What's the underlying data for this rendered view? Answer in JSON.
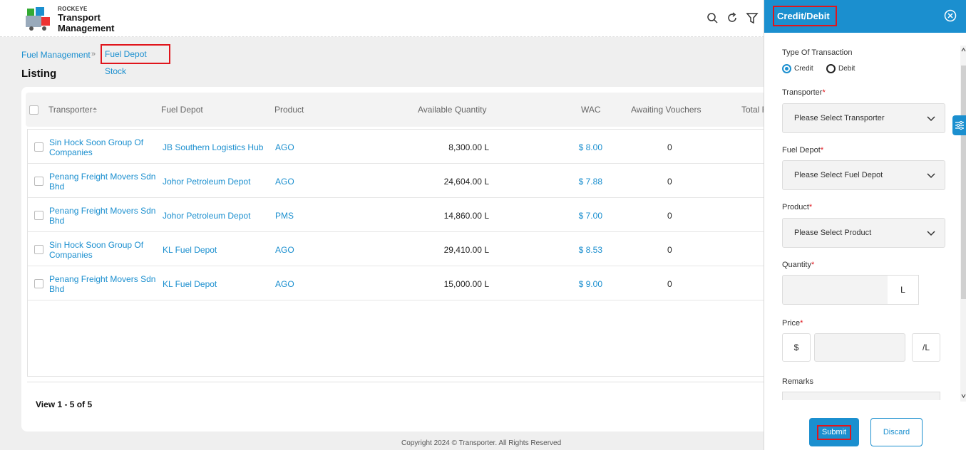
{
  "header": {
    "brand_small": "ROCKEYE",
    "brand_line1": "Transport",
    "brand_line2": "Management",
    "icons": [
      "search-icon",
      "refresh-icon",
      "filter-icon"
    ]
  },
  "breadcrumb": {
    "parent": "Fuel Management",
    "current": "Fuel Depot Stock"
  },
  "page_title": "Listing",
  "table": {
    "columns": [
      "Transporter",
      "Fuel Depot",
      "Product",
      "Available Quantity",
      "WAC",
      "Awaiting Vouchers",
      "Total F"
    ],
    "rows": [
      {
        "transporter": "Sin Hock Soon Group Of Companies",
        "depot": "JB Southern Logistics Hub",
        "product": "AGO",
        "qty": "8,300.00 L",
        "wac": "$ 8.00",
        "vouchers": "0"
      },
      {
        "transporter": "Penang Freight Movers Sdn Bhd",
        "depot": "Johor Petroleum Depot",
        "product": "AGO",
        "qty": "24,604.00 L",
        "wac": "$ 7.88",
        "vouchers": "0"
      },
      {
        "transporter": "Penang Freight Movers Sdn Bhd",
        "depot": "Johor Petroleum Depot",
        "product": "PMS",
        "qty": "14,860.00 L",
        "wac": "$ 7.00",
        "vouchers": "0"
      },
      {
        "transporter": "Sin Hock Soon Group Of Companies",
        "depot": "KL Fuel Depot",
        "product": "AGO",
        "qty": "29,410.00 L",
        "wac": "$ 8.53",
        "vouchers": "0"
      },
      {
        "transporter": "Penang Freight Movers Sdn Bhd",
        "depot": "KL Fuel Depot",
        "product": "AGO",
        "qty": "15,000.00 L",
        "wac": "$ 9.00",
        "vouchers": "0"
      }
    ],
    "view_count": "View 1 - 5 of 5"
  },
  "footer": {
    "copyright": "Copyright 2024 © Transporter. All Rights Reserved"
  },
  "panel": {
    "title": "Credit/Debit",
    "type_label": "Type Of Transaction",
    "options": [
      "Credit",
      "Debit"
    ],
    "selected_option": "Credit",
    "transporter_label": "Transporter",
    "transporter_placeholder": "Please Select Transporter",
    "depot_label": "Fuel Depot",
    "depot_placeholder": "Please Select Fuel Depot",
    "product_label": "Product",
    "product_placeholder": "Please Select Product",
    "quantity_label": "Quantity",
    "quantity_unit": "L",
    "price_label": "Price",
    "price_currency": "$",
    "price_unit": "/L",
    "remarks_label": "Remarks",
    "submit": "Submit",
    "discard": "Discard",
    "required_mark": "*"
  },
  "colors": {
    "accent": "#1b8fcf",
    "highlight": "#e0151c"
  }
}
